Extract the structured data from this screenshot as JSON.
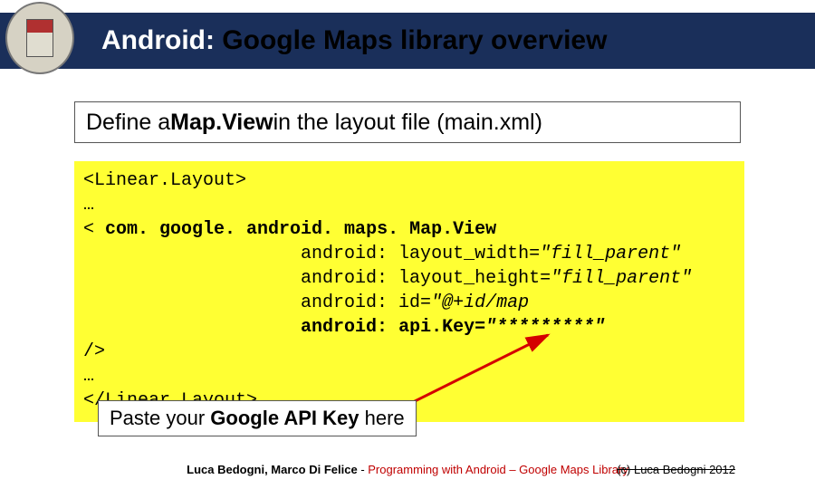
{
  "header": {
    "title_part1": "Android:",
    "title_part2": " Google Maps library overview"
  },
  "instruction": {
    "pre": "Define a ",
    "bold": "Map.View",
    "post": " in the layout file (main.xml)"
  },
  "code": {
    "l1": "<Linear.Layout>",
    "l2": "…",
    "l3a": "< ",
    "l3b": "com. google. android. maps. Map.View",
    "l4a": "                    android: layout_width=",
    "l4b": "\"fill_parent\"",
    "l5a": "                    android: layout_height=",
    "l5b": "\"fill_parent\"",
    "l6a": "                    android: id=",
    "l6b": "\"@+id/map",
    "l7a": "                    ",
    "l7b": "android: api.Key=",
    "l7c": "\"*********\"",
    "l8": "/>",
    "l9": "…",
    "l10": "</Linear.Layout>"
  },
  "callout": {
    "pre": "Paste your ",
    "bold": "Google API Key",
    "post": " here"
  },
  "footer": {
    "authors": "Luca Bedogni, Marco Di Felice",
    "sep": " - ",
    "course": "Programming with Android – Google Maps Library",
    "page": "(c) Luca Bedogni 2012"
  }
}
